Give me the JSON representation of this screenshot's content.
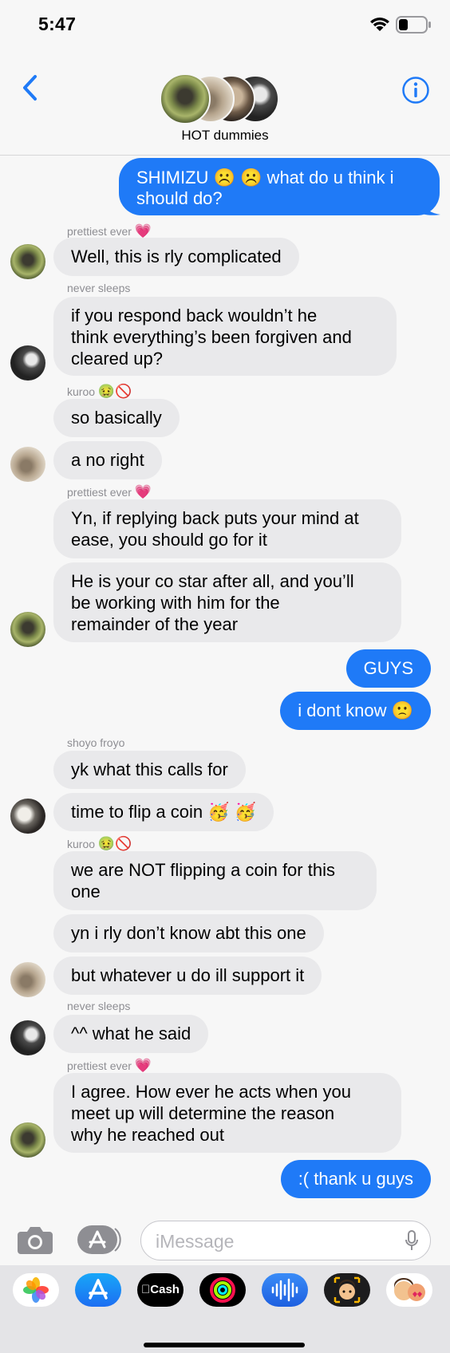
{
  "status_bar": {
    "time": "5:47",
    "battery_level": 0.35
  },
  "header": {
    "group_name": "HOT dummies",
    "back_icon": "chevron-left-icon",
    "info_icon": "info-icon"
  },
  "messages": {
    "m1": {
      "text_line1": "SHIMIZU ☹️ ☹️  what do u think i",
      "text_line2": "should do?"
    },
    "s1": {
      "name": "prettiest ever",
      "emoji": "💗"
    },
    "m2": {
      "text": "Well, this is rly complicated"
    },
    "s2": {
      "name": "never sleeps"
    },
    "m3": {
      "line1": "if you respond back wouldn’t he",
      "line2": "think everything’s been forgiven and",
      "line3": "cleared up?"
    },
    "s3": {
      "name": "kuroo",
      "emoji": "🤢🚫"
    },
    "m4": {
      "text": "so basically"
    },
    "m5": {
      "text": "a no right"
    },
    "s4": {
      "name": "prettiest ever",
      "emoji": "💗"
    },
    "m6": {
      "line1": "Yn, if replying back puts your mind at",
      "line2": "ease, you should go for it"
    },
    "m7": {
      "line1": "He is your co star after all, and you’ll",
      "line2": "be working with him for the",
      "line3": "remainder of the year"
    },
    "m8": {
      "text": "GUYS"
    },
    "m9": {
      "text": "i dont know 🙁"
    },
    "s5": {
      "name": "shoyo froyo"
    },
    "m10": {
      "text": "yk what this calls for"
    },
    "m11": {
      "text": "time to flip a coin 🥳 🥳"
    },
    "s6": {
      "name": "kuroo",
      "emoji": "🤢🚫"
    },
    "m12": {
      "line1": "we are NOT flipping a coin for this",
      "line2": "one"
    },
    "m13": {
      "text": "yn i rly don’t know abt this one"
    },
    "m14": {
      "text": "but whatever u do ill support it"
    },
    "s7": {
      "name": "never sleeps"
    },
    "m15": {
      "text": "^^ what he said"
    },
    "s8": {
      "name": "prettiest ever",
      "emoji": "💗"
    },
    "m16": {
      "line1": "I agree. How ever he acts when you",
      "line2": "meet up will determine the reason",
      "line3": "why he reached out"
    },
    "m17": {
      "text": ":( thank u guys"
    }
  },
  "input": {
    "placeholder": "iMessage"
  },
  "app_drawer": {
    "apps": [
      "photos-icon",
      "app-store-icon",
      "apple-cash-icon",
      "activity-icon",
      "audio-message-icon",
      "memoji-icon",
      "memoji-stickers-icon"
    ],
    "cash_label": "Cash"
  },
  "colors": {
    "outgoing_bubble": "#1f7af7",
    "incoming_bubble": "#e9e9eb",
    "accent": "#1f7af7",
    "sender_name": "#8e8e93"
  }
}
